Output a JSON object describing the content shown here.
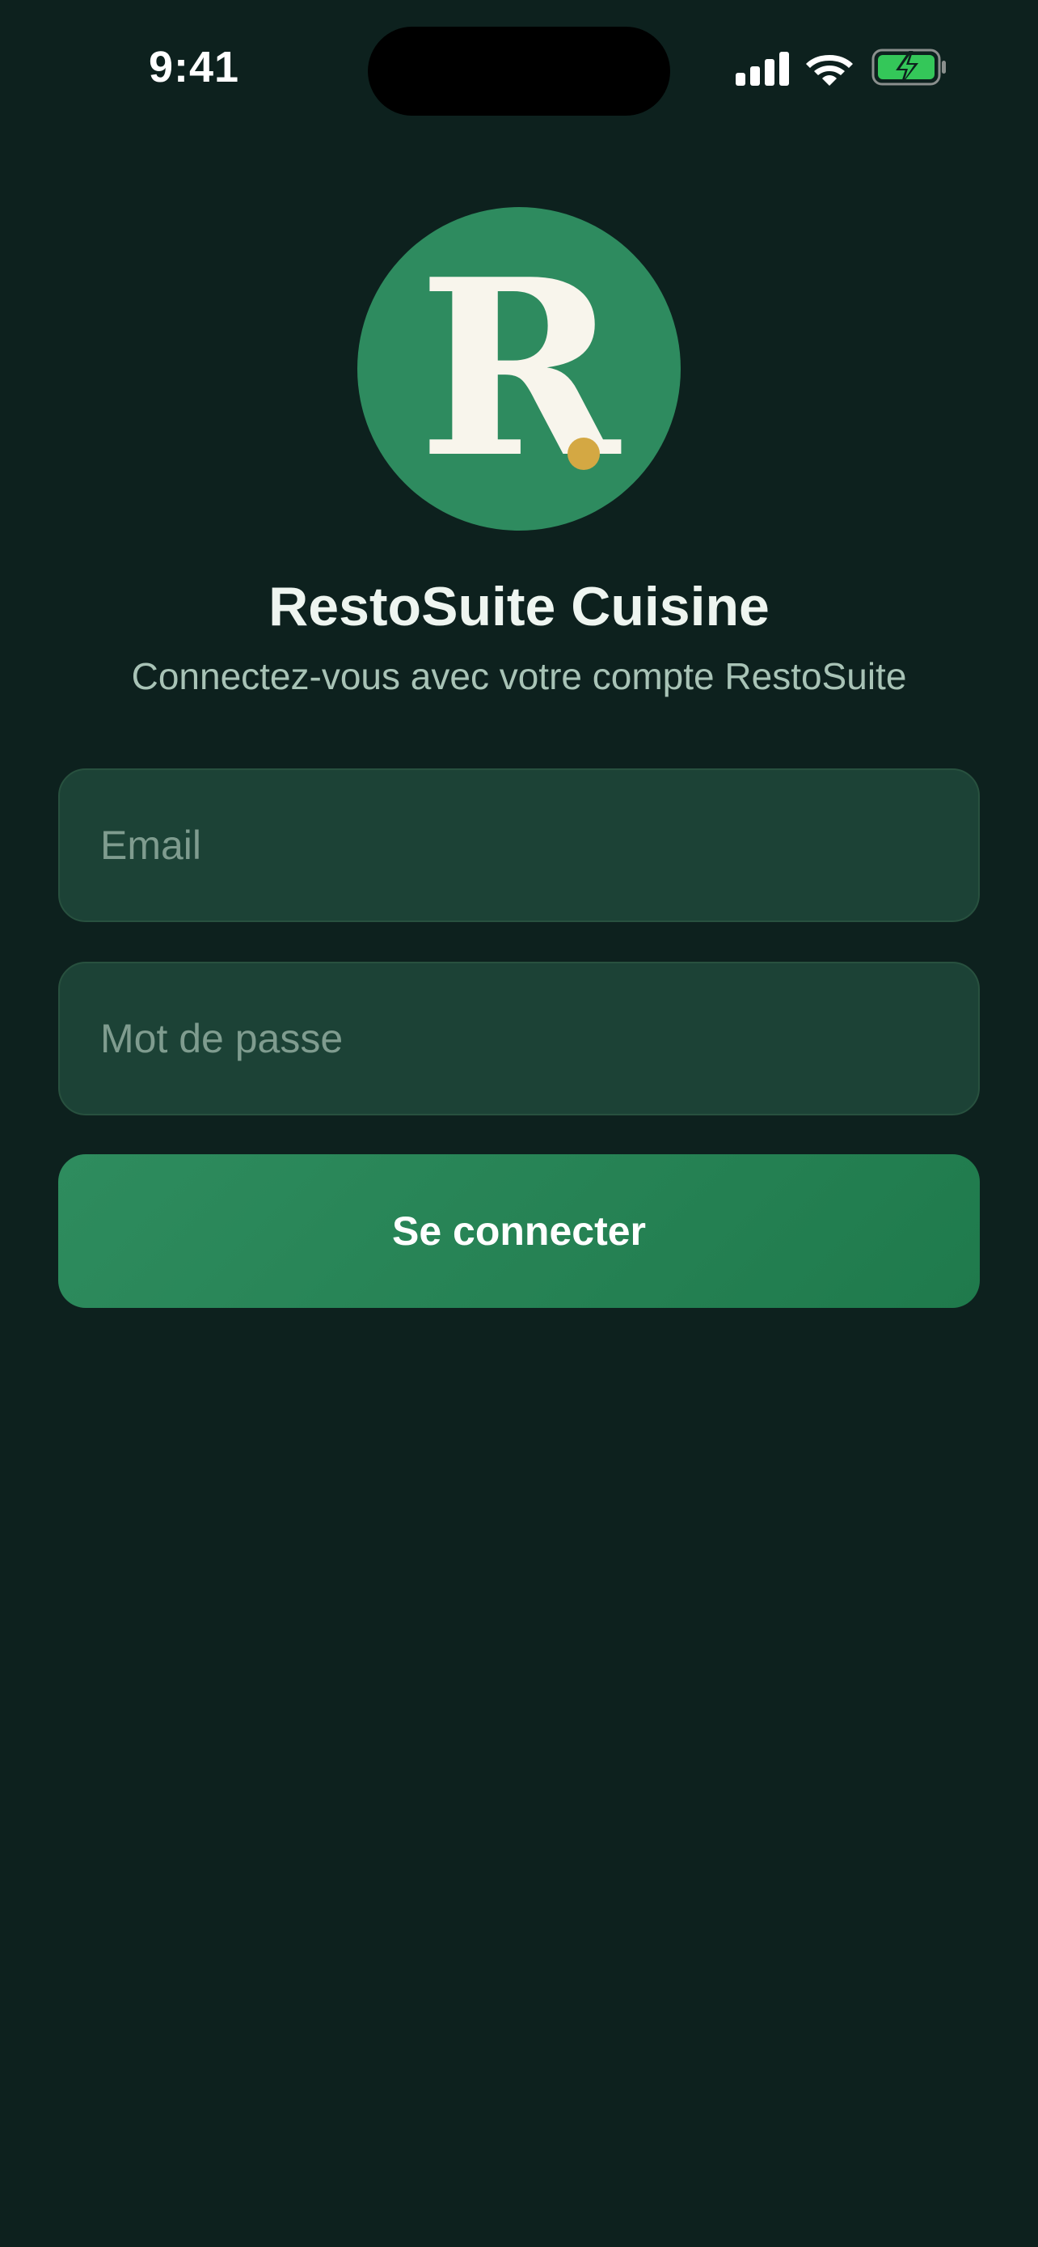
{
  "status_bar": {
    "time": "9:41",
    "icons": [
      "signal-icon",
      "wifi-icon",
      "battery-charging-icon"
    ]
  },
  "logo": {
    "letter": "R",
    "colors": {
      "circle": "#2e8b5f",
      "letter": "#f8f5ec",
      "dot": "#d4a843"
    }
  },
  "header": {
    "title": "RestoSuite Cuisine",
    "subtitle": "Connectez-vous avec votre compte RestoSuite"
  },
  "form": {
    "email": {
      "value": "",
      "placeholder": "Email"
    },
    "password": {
      "value": "",
      "placeholder": "Mot de passe"
    },
    "submit_label": "Se connecter"
  },
  "theme": {
    "background": "#0d211e",
    "field_background": "#1c4236",
    "accent": "#2e8b5f",
    "battery": "#34c759"
  }
}
